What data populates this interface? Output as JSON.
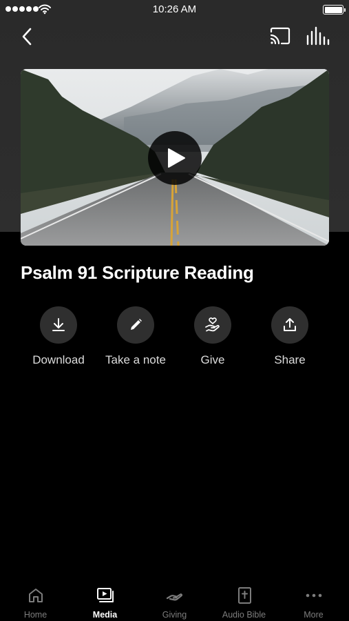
{
  "status_bar": {
    "time": "10:26 AM"
  },
  "nav": {
    "back_icon": "chevron-left-icon",
    "cast_icon": "cast-icon",
    "audio_icon": "audio-bars-icon"
  },
  "video": {
    "thumbnail": "mountain road landscape",
    "play_icon": "play-icon"
  },
  "title": "Psalm 91 Scripture Reading",
  "actions": [
    {
      "label": "Download",
      "icon": "download-icon"
    },
    {
      "label": "Take a note",
      "icon": "pencil-icon"
    },
    {
      "label": "Give",
      "icon": "heart-hand-icon"
    },
    {
      "label": "Share",
      "icon": "share-icon"
    }
  ],
  "tabs": [
    {
      "label": "Home",
      "icon": "home-icon",
      "active": false
    },
    {
      "label": "Media",
      "icon": "media-play-icon",
      "active": true
    },
    {
      "label": "Giving",
      "icon": "giving-hand-icon",
      "active": false
    },
    {
      "label": "Audio Bible",
      "icon": "bible-icon",
      "active": false
    },
    {
      "label": "More",
      "icon": "more-dots-icon",
      "active": false
    }
  ],
  "colors": {
    "background": "#000000",
    "header_background": "#2c2c2c",
    "action_circle": "#2f2f2f",
    "tab_inactive": "#7d7d7d",
    "tab_active": "#ffffff"
  }
}
